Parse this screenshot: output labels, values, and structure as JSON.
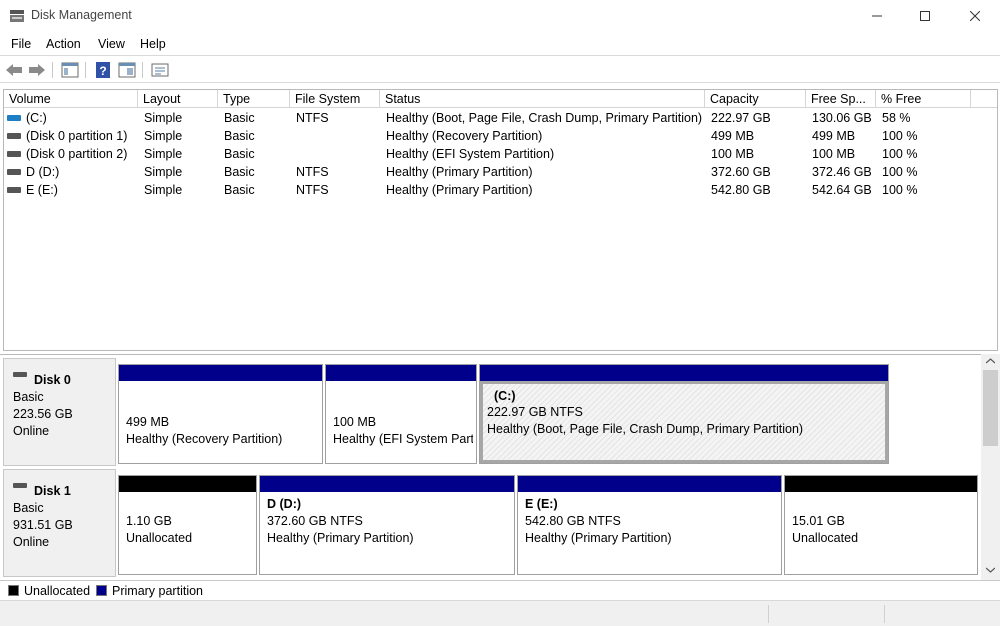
{
  "window": {
    "title": "Disk Management"
  },
  "menu": [
    "File",
    "Action",
    "View",
    "Help"
  ],
  "toolbar": [
    "back-arrow-icon",
    "forward-arrow-icon",
    "console-tree-icon",
    "help-icon",
    "properties-icon",
    "settings-list-icon"
  ],
  "columns": [
    "Volume",
    "Layout",
    "Type",
    "File System",
    "Status",
    "Capacity",
    "Free Sp...",
    "% Free"
  ],
  "volumes": [
    {
      "volume": "(C:)",
      "layout": "Simple",
      "type": "Basic",
      "fs": "NTFS",
      "status": "Healthy (Boot, Page File, Crash Dump, Primary Partition)",
      "capacity": "222.97 GB",
      "free": "130.06 GB",
      "pct": "58 %",
      "icon_color": "#1f7fc4"
    },
    {
      "volume": "(Disk 0 partition 1)",
      "layout": "Simple",
      "type": "Basic",
      "fs": "",
      "status": "Healthy (Recovery Partition)",
      "capacity": "499 MB",
      "free": "499 MB",
      "pct": "100 %",
      "icon_color": "#555555"
    },
    {
      "volume": "(Disk 0 partition 2)",
      "layout": "Simple",
      "type": "Basic",
      "fs": "",
      "status": "Healthy (EFI System Partition)",
      "capacity": "100 MB",
      "free": "100 MB",
      "pct": "100 %",
      "icon_color": "#555555"
    },
    {
      "volume": "D (D:)",
      "layout": "Simple",
      "type": "Basic",
      "fs": "NTFS",
      "status": "Healthy (Primary Partition)",
      "capacity": "372.60 GB",
      "free": "372.46 GB",
      "pct": "100 %",
      "icon_color": "#555555"
    },
    {
      "volume": "E (E:)",
      "layout": "Simple",
      "type": "Basic",
      "fs": "NTFS",
      "status": "Healthy (Primary Partition)",
      "capacity": "542.80 GB",
      "free": "542.64 GB",
      "pct": "100 %",
      "icon_color": "#555555"
    }
  ],
  "disks": [
    {
      "name": "Disk 0",
      "kind": "Basic",
      "size": "223.56 GB",
      "state": "Online",
      "partitions": [
        {
          "title": "",
          "line1": "499 MB",
          "line2": "Healthy (Recovery Partition)",
          "bar": "#00008b"
        },
        {
          "title": "",
          "line1": "100 MB",
          "line2": "Healthy (EFI System Part",
          "bar": "#00008b"
        },
        {
          "title": "(C:)",
          "line1": "222.97 GB NTFS",
          "line2": "Healthy (Boot, Page File, Crash Dump, Primary Partition)",
          "bar": "#00008b"
        }
      ]
    },
    {
      "name": "Disk 1",
      "kind": "Basic",
      "size": "931.51 GB",
      "state": "Online",
      "partitions": [
        {
          "title": "",
          "line1": "1.10 GB",
          "line2": "Unallocated",
          "bar": "#000000"
        },
        {
          "title": "D  (D:)",
          "line1": "372.60 GB NTFS",
          "line2": "Healthy (Primary Partition)",
          "bar": "#00008b"
        },
        {
          "title": "E  (E:)",
          "line1": "542.80 GB NTFS",
          "line2": "Healthy (Primary Partition)",
          "bar": "#00008b"
        },
        {
          "title": "",
          "line1": "15.01 GB",
          "line2": "Unallocated",
          "bar": "#000000"
        }
      ]
    }
  ],
  "legend": [
    {
      "label": "Unallocated",
      "color": "#000000"
    },
    {
      "label": "Primary partition",
      "color": "#00008b"
    }
  ]
}
